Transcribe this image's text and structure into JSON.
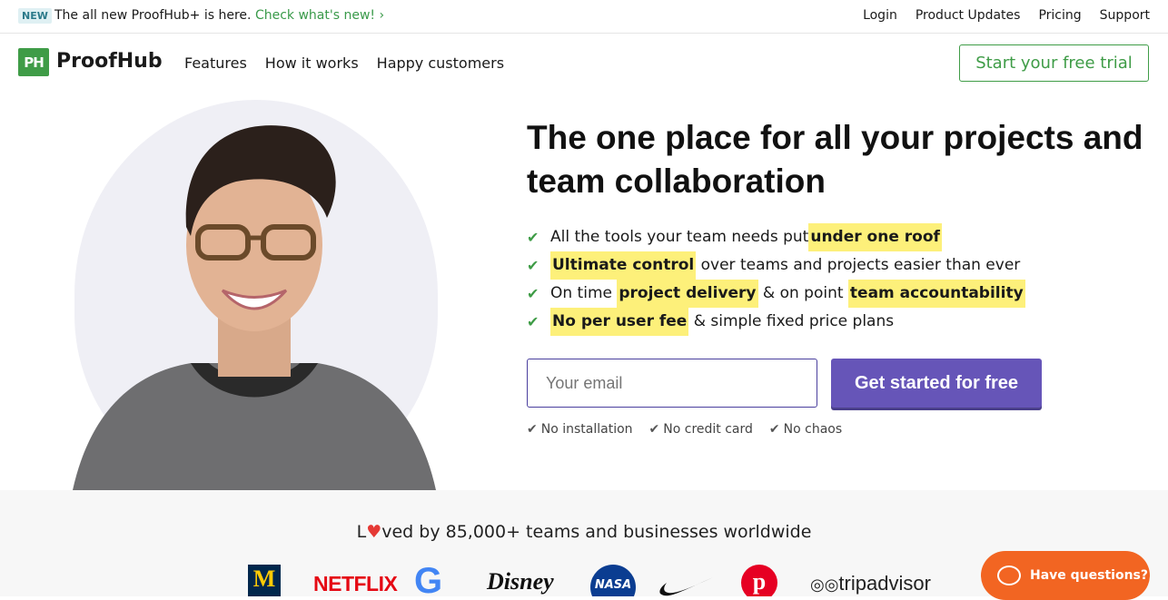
{
  "announcement": {
    "badge": "NEW",
    "text": "The all new ProofHub+ is here.",
    "link": "Check what's new! ›"
  },
  "topnav": [
    "Login",
    "Product Updates",
    "Pricing",
    "Support"
  ],
  "brand": {
    "mark": "PH",
    "name": "ProofHub"
  },
  "mainnav": [
    "Features",
    "How it works",
    "Happy customers"
  ],
  "trial_button": "Start your free trial",
  "hero": {
    "headline": "The one place for all your projects and team collaboration",
    "bullets": [
      {
        "before": "All the tools your team needs put ",
        "hl1": "under one roof",
        "mid": "",
        "hl2": "",
        "after": ""
      },
      {
        "before": "",
        "hl1": "Ultimate control",
        "mid": " over teams and projects easier than ever",
        "hl2": "",
        "after": ""
      },
      {
        "before": "On time ",
        "hl1": "project delivery",
        "mid": " & on point ",
        "hl2": "team accountability",
        "after": ""
      },
      {
        "before": "",
        "hl1": "No per user fee",
        "mid": " & simple fixed price plans",
        "hl2": "",
        "after": ""
      }
    ],
    "email_placeholder": "Your email",
    "cta": "Get started for free",
    "perks": [
      "No installation",
      "No credit card",
      "No chaos"
    ]
  },
  "social_proof": {
    "loved_prefix": "L",
    "loved_heart": "♥",
    "loved_suffix": "ved by 85,000+ teams and businesses worldwide",
    "logos": [
      "M",
      "NETFLIX",
      "G",
      "Disney",
      "NASA",
      "nike",
      "pinterest",
      "tripadvisor"
    ]
  },
  "chat": {
    "label": "Have questions?"
  },
  "colors": {
    "brand_green": "#3f9c47",
    "cta_purple": "#6655b8",
    "highlight": "#fdf07a",
    "chat_orange": "#f26522"
  }
}
